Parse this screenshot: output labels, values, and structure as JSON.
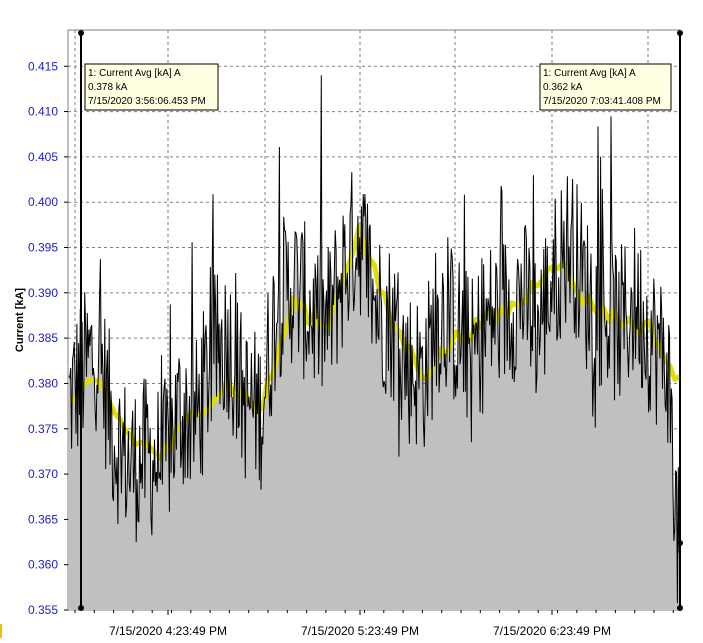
{
  "chart_data": {
    "type": "area",
    "ylabel": "Current [kA]",
    "xlabel": "",
    "title": "",
    "ylim": [
      0.355,
      0.419
    ],
    "y_ticks": [
      0.355,
      0.36,
      0.365,
      0.37,
      0.375,
      0.38,
      0.385,
      0.39,
      0.395,
      0.4,
      0.405,
      0.41,
      0.415
    ],
    "y_tick_labels": [
      "0.355",
      "0.360",
      "0.365",
      "0.370",
      "0.375",
      "0.380",
      "0.385",
      "0.390",
      "0.395",
      "0.400",
      "0.405",
      "0.410",
      "0.415"
    ],
    "x_tick_labels": [
      "7/15/2020 4:23:49 PM",
      "7/15/2020 5:23:49 PM",
      "7/15/2020 6:23:49 PM"
    ],
    "x_range": [
      "7/15/2020 3:56:06 PM",
      "7/15/2020 7:03:41 PM"
    ],
    "grid": true,
    "series": [
      {
        "kind": "raw",
        "color": "#000000",
        "fill": "#c0c0c0",
        "x": [
          "3:56",
          "4:00",
          "4:05",
          "4:10",
          "4:15",
          "4:20",
          "4:25",
          "4:30",
          "4:35",
          "4:40",
          "4:45",
          "4:50",
          "4:55",
          "5:00",
          "5:05",
          "5:10",
          "5:15",
          "5:20",
          "5:25",
          "5:30",
          "5:35",
          "5:40",
          "5:45",
          "5:50",
          "5:55",
          "6:00",
          "6:05",
          "6:10",
          "6:15",
          "6:20",
          "6:25",
          "6:30",
          "6:35",
          "6:40",
          "6:45",
          "6:50",
          "6:55",
          "7:00",
          "7:03"
        ],
        "values": [
          0.378,
          0.381,
          0.384,
          0.374,
          0.371,
          0.372,
          0.371,
          0.377,
          0.376,
          0.383,
          0.385,
          0.378,
          0.377,
          0.389,
          0.391,
          0.388,
          0.386,
          0.392,
          0.397,
          0.389,
          0.387,
          0.382,
          0.381,
          0.388,
          0.386,
          0.383,
          0.387,
          0.388,
          0.39,
          0.386,
          0.392,
          0.396,
          0.39,
          0.388,
          0.386,
          0.389,
          0.385,
          0.382,
          0.362
        ]
      },
      {
        "kind": "average",
        "color": "#e0e000",
        "x": [
          "3:56",
          "4:05",
          "4:15",
          "4:25",
          "4:35",
          "4:45",
          "4:55",
          "5:05",
          "5:15",
          "5:25",
          "5:35",
          "5:45",
          "5:55",
          "6:05",
          "6:15",
          "6:25",
          "6:35",
          "6:45",
          "6:55",
          "7:03"
        ],
        "values": [
          0.378,
          0.38,
          0.374,
          0.372,
          0.377,
          0.38,
          0.377,
          0.389,
          0.386,
          0.397,
          0.387,
          0.381,
          0.385,
          0.387,
          0.389,
          0.394,
          0.389,
          0.387,
          0.386,
          0.38
        ]
      }
    ],
    "cursors": [
      {
        "label": "1: Current Avg [kA] A",
        "value": "0.378 kA",
        "time": "7/15/2020 3:56:06.453 PM"
      },
      {
        "label": "1: Current Avg [kA] A",
        "value": "0.362 kA",
        "time": "7/15/2020 7:03:41.408 PM"
      }
    ]
  },
  "colors": {
    "plot_bg": "#ffffff",
    "area_fill": "#c0c0c0",
    "raw_line": "#000000",
    "avg_line": "#e0e000",
    "grid": "#808080",
    "tick_y": "#1c1cc8",
    "tooltip_bg": "#ffffe1"
  }
}
